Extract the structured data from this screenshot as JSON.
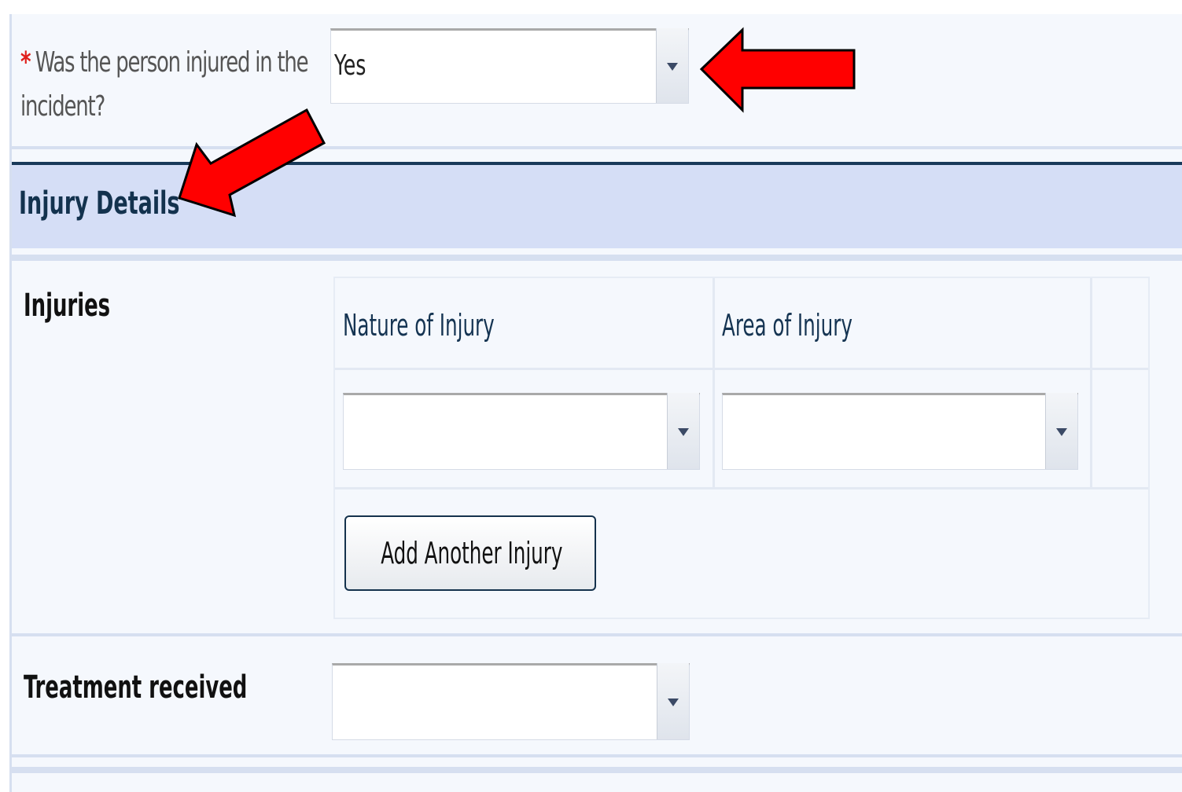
{
  "question": {
    "required_marker": "*",
    "label": "Was the person injured in the incident?",
    "value": "Yes"
  },
  "section": {
    "title": "Injury Details"
  },
  "injuries": {
    "label": "Injuries",
    "columns": [
      "Nature of Injury",
      "Area of Injury"
    ],
    "nature_value": "",
    "area_value": "",
    "add_button": "Add Another Injury"
  },
  "treatment": {
    "label": "Treatment received",
    "value": ""
  },
  "colors": {
    "required": "#e0201c",
    "section_bg": "#d5def6",
    "section_border": "#193a5a",
    "annotation_arrow": "#ff0000"
  },
  "icons": [
    "dropdown-arrow-icon",
    "annotation-arrow-icon"
  ]
}
